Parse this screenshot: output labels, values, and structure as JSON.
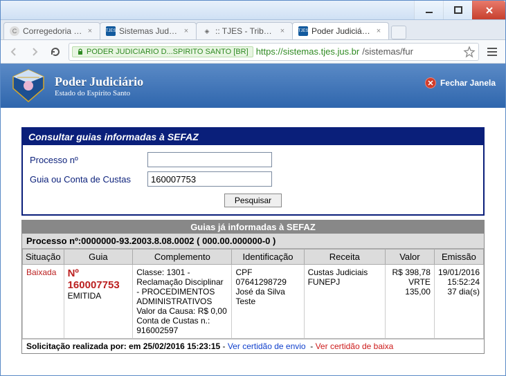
{
  "browser": {
    "tabs": [
      {
        "label": "Corregedoria Ge",
        "favicon": "C"
      },
      {
        "label": "Sistemas Judicia",
        "favicon": "TJES"
      },
      {
        "label": ":: TJES - Tribunal",
        "favicon": "⚙"
      },
      {
        "label": "Poder Judiciário",
        "favicon": "TJES"
      }
    ],
    "ssl_label": "PODER JUDICIARIO D...SPIRITO SANTO [BR]",
    "url_host": "https://sistemas.tjes.jus.br",
    "url_path": "/sistemas/fur"
  },
  "banner": {
    "title": "Poder Judiciário",
    "subtitle": "Estado do Espírito Santo",
    "close_label": "Fechar Janela"
  },
  "form": {
    "panel_title": "Consultar guias informadas à SEFAZ",
    "processo_label": "Processo nº",
    "processo_value": "",
    "guia_label": "Guia ou Conta de Custas",
    "guia_value": "160007753",
    "search_btn": "Pesquisar"
  },
  "results": {
    "section_title": "Guias já informadas à SEFAZ",
    "process_line": "Processo nº:0000000-93.2003.8.08.0002 ( 000.00.000000-0 )",
    "columns": [
      "Situação",
      "Guia",
      "Complemento",
      "Identificação",
      "Receita",
      "Valor",
      "Emissão"
    ],
    "row": {
      "situacao": "Baixada",
      "guia_num": "Nº 160007753",
      "guia_status": "EMITIDA",
      "complemento": "Classe: 1301 - Reclamação Disciplinar - PROCEDIMENTOS ADMINISTRATIVOS\nValor da Causa: R$ 0,00\nConta de Custas n.: 916002597",
      "identificacao": "CPF 07641298729\nJosé da Silva Teste",
      "receita": "Custas Judiciais FUNEPJ",
      "valor": "R$ 398,78\nVRTE 135,00",
      "emissao": "19/01/2016\n15:52:24\n37 dia(s)"
    },
    "footer_prefix": "Solicitação realizada por: em ",
    "footer_datetime": "25/02/2016 15:23:15",
    "footer_sep": " - ",
    "link_envio": "Ver certidão de envio",
    "link_baixa": "Ver certidão de baixa"
  }
}
